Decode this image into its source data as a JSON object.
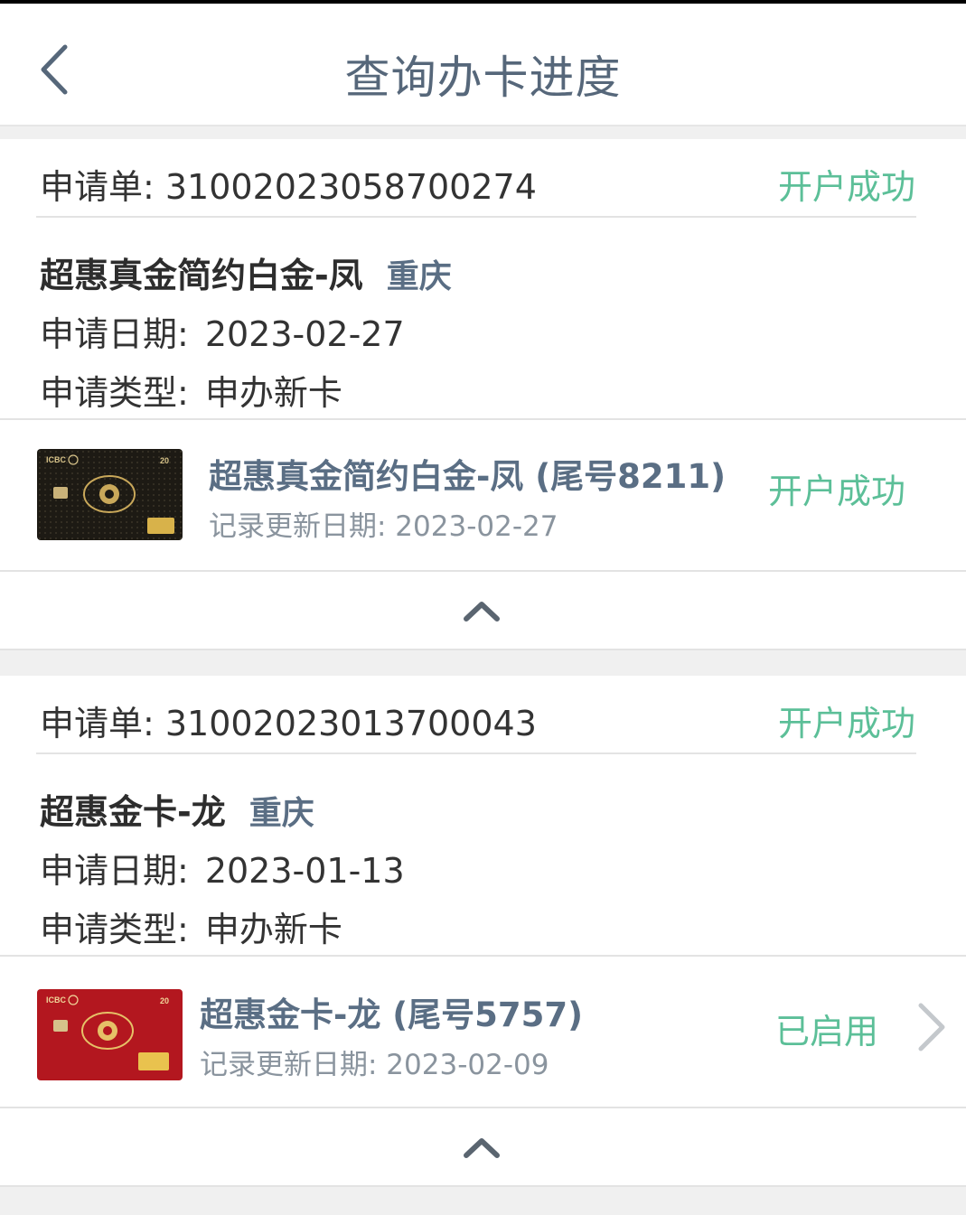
{
  "header": {
    "title": "查询办卡进度",
    "back_icon": "chevron-left-icon"
  },
  "colors": {
    "success": "#5cbf98",
    "title": "#56677a",
    "label": "#333333",
    "muted": "#8a949e"
  },
  "applications": [
    {
      "order_label": "申请单: 3100202305870027­4",
      "order_status": "开户成功",
      "product_name": "超惠真金简约白金-凤",
      "city": "重庆",
      "date_label": "申请日期:",
      "date_value": "2023-02-27",
      "type_label": "申请类型:",
      "type_value": "申办新卡",
      "card": {
        "title": "超惠真金简约白金-凤 (尾号8211)",
        "update": "记录更新日期: 2023-02-27",
        "status": "开户成功",
        "color": "black"
      }
    },
    {
      "order_label": "申请单: 3100202301370004­3",
      "order_status": "开户成功",
      "product_name": "超惠金卡-龙",
      "city": "重庆",
      "date_label": "申请日期:",
      "date_value": "2023-01-13",
      "type_label": "申请类型:",
      "type_value": "申办新卡",
      "card": {
        "title": "超惠金卡-龙 (尾号5757)",
        "update": "记录更新日期: 2023-02-09",
        "status": "已启用",
        "color": "red"
      }
    }
  ],
  "card_brand": "ICBC"
}
